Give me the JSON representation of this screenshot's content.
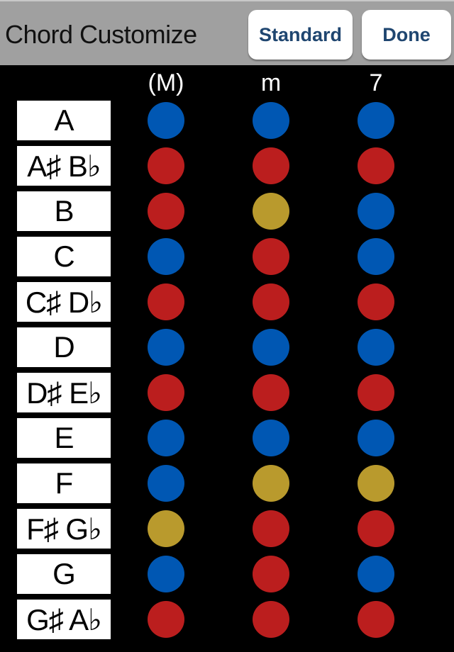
{
  "header": {
    "title": "Chord Customize",
    "standard_label": "Standard",
    "done_label": "Done"
  },
  "columns": [
    "(M)",
    "m",
    "7"
  ],
  "colors": {
    "blue": "#0057b3",
    "red": "#bb1e1e",
    "yellow": "#b99a2d"
  },
  "rows": [
    {
      "label": "A",
      "states": [
        "blue",
        "blue",
        "blue"
      ]
    },
    {
      "label": "A♯ B♭",
      "states": [
        "red",
        "red",
        "red"
      ]
    },
    {
      "label": "B",
      "states": [
        "red",
        "yellow",
        "blue"
      ]
    },
    {
      "label": "C",
      "states": [
        "blue",
        "red",
        "blue"
      ]
    },
    {
      "label": "C♯ D♭",
      "states": [
        "red",
        "red",
        "red"
      ]
    },
    {
      "label": "D",
      "states": [
        "blue",
        "blue",
        "blue"
      ]
    },
    {
      "label": "D♯ E♭",
      "states": [
        "red",
        "red",
        "red"
      ]
    },
    {
      "label": "E",
      "states": [
        "blue",
        "blue",
        "blue"
      ]
    },
    {
      "label": "F",
      "states": [
        "blue",
        "yellow",
        "yellow"
      ]
    },
    {
      "label": "F♯ G♭",
      "states": [
        "yellow",
        "red",
        "red"
      ]
    },
    {
      "label": "G",
      "states": [
        "blue",
        "red",
        "blue"
      ]
    },
    {
      "label": "G♯ A♭",
      "states": [
        "red",
        "red",
        "red"
      ]
    }
  ]
}
